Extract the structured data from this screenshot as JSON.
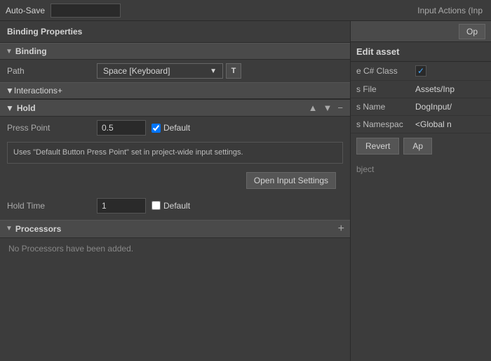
{
  "topbar": {
    "autosave_label": "Auto-Save",
    "search_placeholder": "",
    "op_button_label": "Op"
  },
  "left_panel": {
    "binding_properties_label": "Binding Properties",
    "binding_section": {
      "label": "Binding",
      "path_label": "Path",
      "path_value": "Space [Keyboard]",
      "t_button": "T"
    },
    "interactions_section": {
      "label": "Interactions",
      "add_icon": "+"
    },
    "hold_section": {
      "label": "Hold",
      "up_icon": "▲",
      "down_icon": "▼",
      "remove_icon": "−",
      "press_point_label": "Press Point",
      "press_point_value": "0.5",
      "default_checkbox_label": "Default",
      "info_text": "Uses \"Default Button Press Point\" set in project-wide input\nsettings.",
      "open_settings_btn": "Open Input Settings",
      "hold_time_label": "Hold Time",
      "hold_time_value": "1",
      "hold_time_default": "Default"
    },
    "processors_section": {
      "label": "Processors",
      "add_icon": "+",
      "no_processors_text": "No Processors have been added."
    }
  },
  "right_panel": {
    "title_label": "Input Actions (Inp",
    "edit_asset_label": "Edit asset",
    "csharp_class_label": "e C# Class",
    "csharp_class_checked": true,
    "s_file_label": "s File",
    "s_file_value": "Assets/Inp",
    "s_name_label": "s Name",
    "s_name_value": "DogInput/",
    "s_namespace_label": "s Namespac",
    "s_namespace_value": "<Global n",
    "revert_btn": "Revert",
    "apply_btn": "Ap",
    "object_label": "bject"
  }
}
